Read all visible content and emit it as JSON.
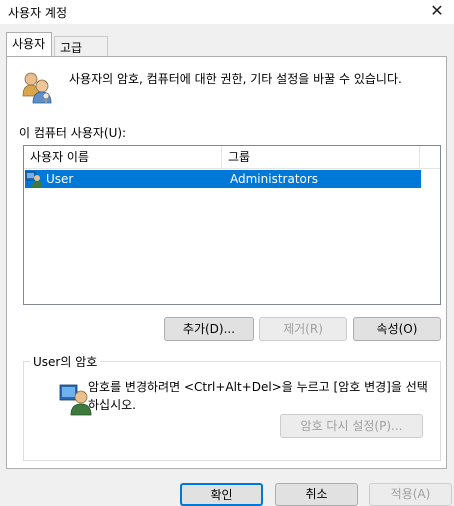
{
  "window": {
    "title": "사용자 계정",
    "close_glyph": "✕"
  },
  "tabs": [
    {
      "label": "사용자",
      "active": true
    },
    {
      "label": "고급",
      "active": false
    }
  ],
  "intro": {
    "text": "사용자의 암호, 컴퓨터에 대한 권한, 기타 설정을 바꿀 수 있습니다.",
    "icon": "users-icon"
  },
  "users_list": {
    "label": "이 컴퓨터 사용자(U):",
    "columns": [
      "사용자 이름",
      "그룹"
    ],
    "rows": [
      {
        "name": "User",
        "group": "Administrators",
        "selected": true,
        "icon": "user-icon"
      }
    ]
  },
  "list_buttons": {
    "add": "추가(D)...",
    "remove": "제거(R)",
    "properties": "속성(O)"
  },
  "password": {
    "group_title": "User의 암호",
    "text": "암호를 변경하려면 <Ctrl+Alt+Del>을 누르고 [암호 변경]을 선택하십시오.",
    "reset_button": "암호 다시 설정(P)...",
    "icon": "user-password-icon"
  },
  "dialog_buttons": {
    "ok": "확인",
    "cancel": "취소",
    "apply": "적용(A)"
  },
  "colors": {
    "selection": "#0078d7",
    "default_border": "#0078d7",
    "disabled_text": "#a0a0a0"
  }
}
